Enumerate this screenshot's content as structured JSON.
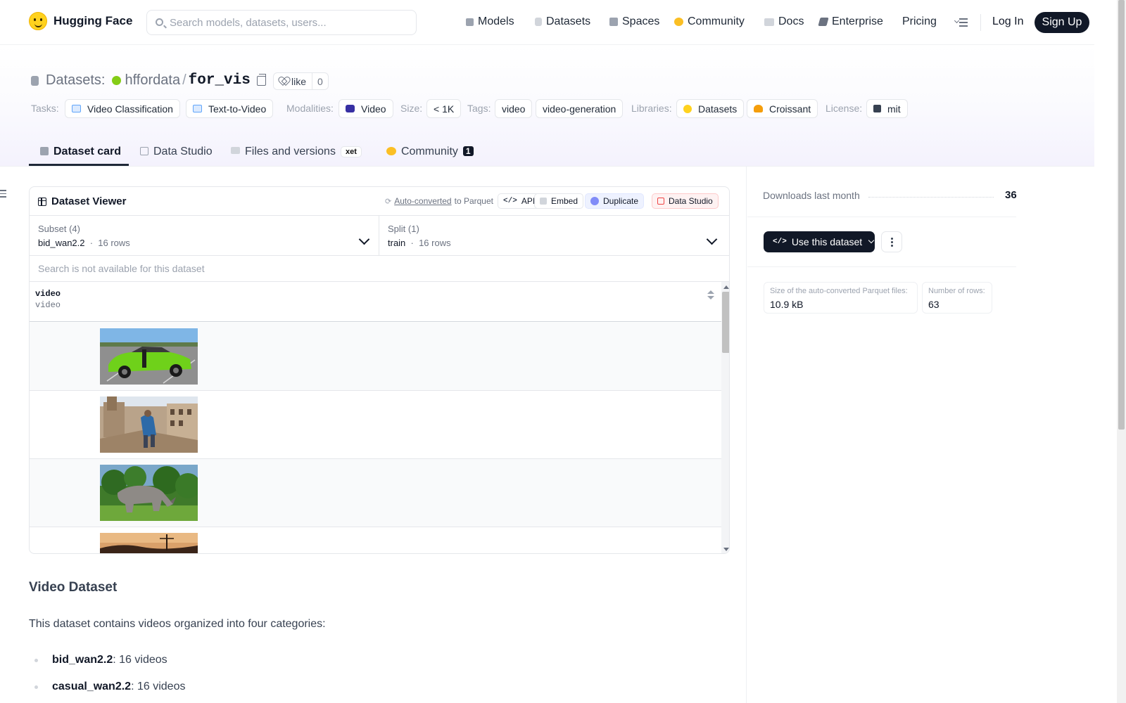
{
  "nav": {
    "brand": "Hugging Face",
    "search_placeholder": "Search models, datasets, users...",
    "items": [
      {
        "label": "Models",
        "icon": "cube-icon"
      },
      {
        "label": "Datasets",
        "icon": "database-icon"
      },
      {
        "label": "Spaces",
        "icon": "spaces-icon"
      },
      {
        "label": "Community",
        "icon": "community-icon"
      },
      {
        "label": "Docs",
        "icon": "book-icon"
      },
      {
        "label": "Enterprise",
        "icon": "enterprise-icon"
      },
      {
        "label": "Pricing"
      }
    ],
    "login": "Log In",
    "signup": "Sign Up"
  },
  "header": {
    "type_label": "Datasets:",
    "org": "hffordata",
    "separator": "/",
    "name": "for_vis",
    "like_label": "like",
    "like_count": "0",
    "meta": {
      "tasks_label": "Tasks:",
      "tasks": [
        "Video Classification",
        "Text-to-Video"
      ],
      "modalities_label": "Modalities:",
      "modalities": [
        "Video"
      ],
      "size_label": "Size:",
      "size": "< 1K",
      "tags_label": "Tags:",
      "tags": [
        "video",
        "video-generation"
      ],
      "libraries_label": "Libraries:",
      "libraries": [
        "Datasets",
        "Croissant"
      ],
      "license_label": "License:",
      "license": "mit"
    }
  },
  "tabs": [
    {
      "label": "Dataset card",
      "active": true
    },
    {
      "label": "Data Studio"
    },
    {
      "label": "Files and versions",
      "badge": "xet"
    },
    {
      "label": "Community",
      "count": "1"
    }
  ],
  "viewer": {
    "title": "Dataset Viewer",
    "auto_link": "Auto-converted",
    "auto_suffix": "to Parquet",
    "buttons": [
      "API",
      "Embed",
      "Duplicate",
      "Data Studio"
    ],
    "subset_title": "Subset (4)",
    "subset_value": "bid_wan2.2",
    "subset_rows": "16 rows",
    "split_title": "Split (1)",
    "split_value": "train",
    "split_rows": "16 rows",
    "search_placeholder": "Search is not available for this dataset",
    "column_name": "video",
    "column_type": "video",
    "rows": [
      "green-car-thumbnail",
      "old-town-person-thumbnail",
      "rhino-thumbnail",
      "sunset-thumbnail"
    ]
  },
  "card": {
    "heading": "Video Dataset",
    "intro": "This dataset contains videos organized into four categories:",
    "items": [
      {
        "name": "bid_wan2.2",
        "desc": ": 16 videos"
      },
      {
        "name": "casual_wan2.2",
        "desc": ": 16 videos"
      }
    ]
  },
  "sidebar": {
    "downloads_label": "Downloads last month",
    "downloads": "36",
    "use_button": "Use this dataset",
    "parquet_label": "Size of the auto-converted Parquet files:",
    "parquet_size": "10.9 kB",
    "rows_label": "Number of rows:",
    "rows": "63"
  },
  "colors": {
    "brand_yellow": "#ffd21e",
    "dark": "#111827",
    "muted": "#6b7280"
  }
}
